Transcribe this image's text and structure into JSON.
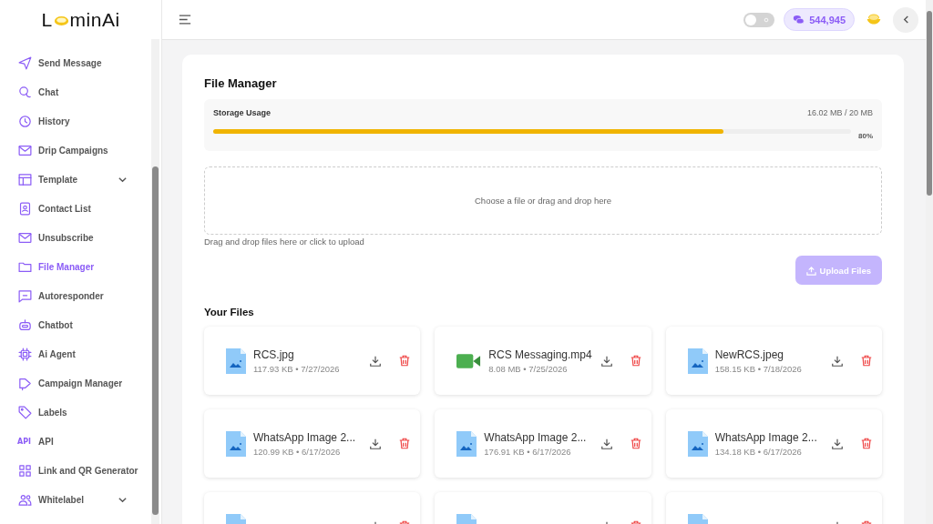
{
  "logo": {
    "before": "L",
    "after": "minAi"
  },
  "sidebar": {
    "items": [
      {
        "label": "Send Message",
        "selected": false
      },
      {
        "label": "Chat",
        "selected": false
      },
      {
        "label": "History",
        "selected": false
      },
      {
        "label": "Drip Campaigns",
        "selected": false
      },
      {
        "label": "Template",
        "selected": false,
        "expandable": true
      },
      {
        "label": "Contact List",
        "selected": false
      },
      {
        "label": "Unsubscribe",
        "selected": false
      },
      {
        "label": "File Manager",
        "selected": true
      },
      {
        "label": "Autoresponder",
        "selected": false
      },
      {
        "label": "Chatbot",
        "selected": false
      },
      {
        "label": "Ai Agent",
        "selected": false
      },
      {
        "label": "Campaign Manager",
        "selected": false
      },
      {
        "label": "Labels",
        "selected": false
      },
      {
        "label": "API",
        "selected": false,
        "badge": "API"
      },
      {
        "label": "Link and QR Generator",
        "selected": false
      },
      {
        "label": "Whitelabel",
        "selected": false,
        "expandable": true
      }
    ]
  },
  "header": {
    "theme_toggle": {
      "on": false
    },
    "credits": "544,945"
  },
  "page": {
    "title": "File Manager",
    "storage": {
      "label": "Storage Usage",
      "reading": "16.02 MB / 20 MB",
      "level": 0.8,
      "percent": "80%"
    },
    "dropzone": {
      "prompt": "Choose a file or drag and drop here",
      "hint": "Drag and drop files here or click to upload"
    },
    "upload_button": {
      "label": "Upload Files",
      "disabled": true
    },
    "files_title": "Your Files",
    "files": [
      {
        "kind": "image",
        "name": "RCS.jpg",
        "meta": "117.93 KB • 7/27/2026"
      },
      {
        "kind": "video",
        "name": "RCS Messaging.mp4",
        "meta": "8.08 MB • 7/25/2026"
      },
      {
        "kind": "image",
        "name": "NewRCS.jpeg",
        "meta": "158.15 KB • 7/18/2026"
      },
      {
        "kind": "image",
        "name": "WhatsApp Image 2...",
        "meta": "120.99 KB • 6/17/2026"
      },
      {
        "kind": "image",
        "name": "WhatsApp Image 2...",
        "meta": "176.91 KB • 6/17/2026"
      },
      {
        "kind": "image",
        "name": "WhatsApp Image 2...",
        "meta": "134.18 KB • 6/17/2026"
      },
      {
        "kind": "image"
      },
      {
        "kind": "image"
      },
      {
        "kind": "image"
      }
    ]
  }
}
